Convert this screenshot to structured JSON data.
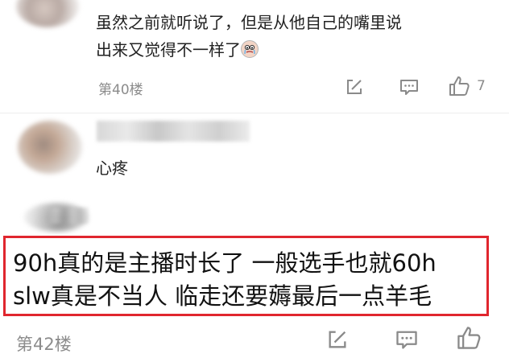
{
  "comments": [
    {
      "text_line1": "虽然之前就听说了，但是从他自己的嘴里说",
      "text_line2": "出来又觉得不一样了",
      "emoji": "crying-face-icon",
      "floor": "第40楼",
      "likes": "7"
    },
    {
      "text": "心疼"
    },
    {
      "text_line1": "90h真的是主播时长了 一般选手也就60h",
      "text_line2": "slw真是不当人 临走还要薅最后一点羊毛",
      "floor": "第42楼"
    }
  ],
  "colors": {
    "highlight_border": "#e0262e",
    "secondary_text": "#8c8c8c",
    "icon": "#8a8a8a"
  },
  "icons": [
    "edit-icon",
    "comment-icon",
    "thumbs-up-icon"
  ]
}
